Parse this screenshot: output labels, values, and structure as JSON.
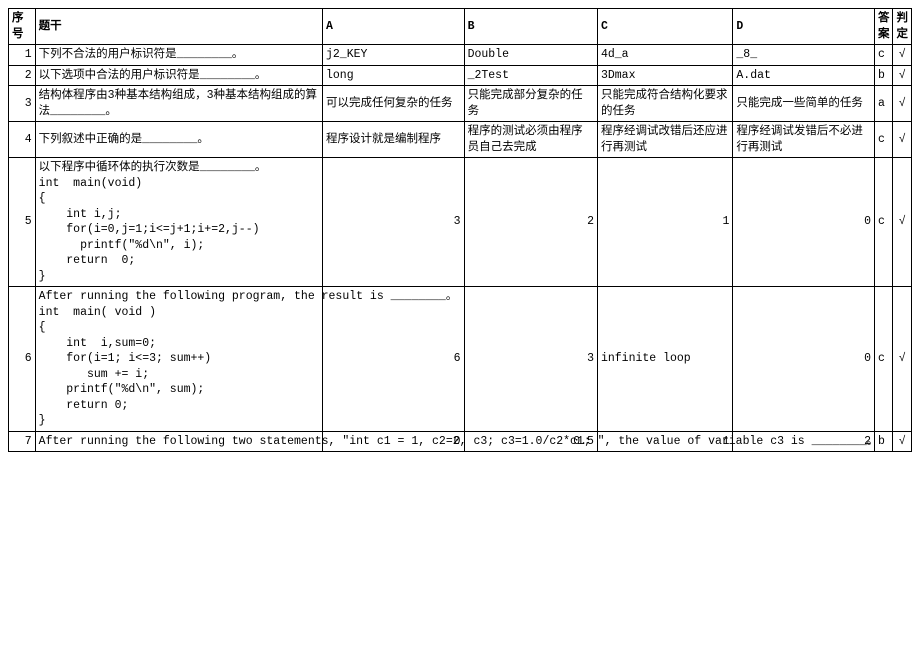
{
  "headers": {
    "seq": "序号",
    "stem": "题干",
    "a": "A",
    "b": "B",
    "c": "C",
    "d": "D",
    "ans": "答案",
    "judge": "判定"
  },
  "rows": [
    {
      "seq": "1",
      "stem": "下列不合法的用户标识符是________。",
      "a": "j2_KEY",
      "b": "Double",
      "c": "4d_a",
      "d": "_8_",
      "ans": "c",
      "judge": "√"
    },
    {
      "seq": "2",
      "stem": "以下选项中合法的用户标识符是________。",
      "a": "long",
      "b": "_2Test",
      "c": "3Dmax",
      "d": "A.dat",
      "ans": "b",
      "judge": "√"
    },
    {
      "seq": "3",
      "stem": "结构体程序由3种基本结构组成，3种基本结构组成的算法________。",
      "a": "可以完成任何复杂的任务",
      "b": "只能完成部分复杂的任务",
      "c": "只能完成符合结构化要求的任务",
      "d": "只能完成一些简单的任务",
      "ans": "a",
      "judge": "√"
    },
    {
      "seq": "4",
      "stem": "下列叙述中正确的是________。",
      "a": "程序设计就是编制程序",
      "b": "程序的测试必须由程序员自己去完成",
      "c": "程序经调试改错后还应进行再测试",
      "d": "程序经调试发错后不必进行再测试",
      "ans": "c",
      "judge": "√"
    },
    {
      "seq": "5",
      "stem": "以下程序中循环体的执行次数是________。\nint  main(void)\n{\n    int i,j;\n    for(i=0,j=1;i<=j+1;i+=2,j--)\n      printf(\"%d\\n\", i);\n    return  0;\n}",
      "a": "3",
      "b": "2",
      "c": "1",
      "d": "0",
      "ans": "c",
      "judge": "√"
    },
    {
      "seq": "6",
      "stem": "After running the following program, the result is ________。\nint  main( void )\n{\n    int  i,sum=0;\n    for(i=1; i<=3; sum++)\n       sum += i;\n    printf(\"%d\\n\", sum);\n    return 0;\n}",
      "a": "6",
      "b": "3",
      "c": "infinite loop",
      "d": "0",
      "ans": "c",
      "judge": "√"
    },
    {
      "seq": "7",
      "stem": "After running the following two statements, \"int c1 = 1, c2=2, c3; c3=1.0/c2*c1; \", the value of variable c3 is ________。",
      "a": "0",
      "b": "0.5",
      "c": "1",
      "d": "2",
      "ans": "b",
      "judge": "√"
    }
  ]
}
